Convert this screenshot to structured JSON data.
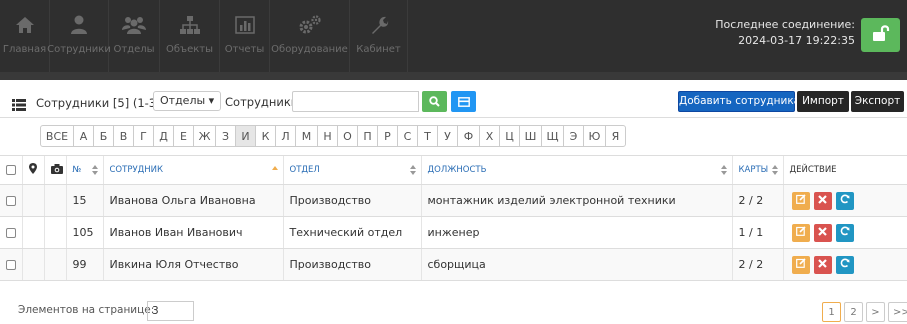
{
  "nav": {
    "items": [
      {
        "label": "Главная",
        "icon": "home-icon"
      },
      {
        "label": "Сотрудники",
        "icon": "user-icon"
      },
      {
        "label": "Отделы",
        "icon": "users-icon"
      },
      {
        "label": "Объекты",
        "icon": "sitemap-icon"
      },
      {
        "label": "Отчеты",
        "icon": "chart-icon"
      },
      {
        "label": "Оборудование",
        "icon": "gears-icon"
      },
      {
        "label": "Кабинет",
        "icon": "wrench-icon"
      }
    ]
  },
  "connection": {
    "label": "Последнее соединение:",
    "timestamp": "2024-03-17 19:22:35"
  },
  "toolbar": {
    "title": "Сотрудники [5] (1-3)",
    "departments_label": "Отделы ▾",
    "employees_label": "Сотрудники",
    "search_value": "",
    "add_label": "Добавить сотрудника",
    "import_label": "Импорт",
    "export_label": "Экспорт"
  },
  "alphabet": {
    "letters": [
      "ВСЕ",
      "А",
      "Б",
      "В",
      "Г",
      "Д",
      "Е",
      "Ж",
      "З",
      "И",
      "К",
      "Л",
      "М",
      "Н",
      "О",
      "П",
      "Р",
      "С",
      "Т",
      "У",
      "Ф",
      "Х",
      "Ц",
      "Ш",
      "Щ",
      "Э",
      "Ю",
      "Я"
    ],
    "active": "И"
  },
  "table": {
    "headers": {
      "num": "№",
      "employee": "Сотрудник",
      "department": "Отдел",
      "position": "Должность",
      "cards": "Карты",
      "action": "Действие"
    },
    "rows": [
      {
        "num": "15",
        "employee": "Иванова Ольга Ивановна",
        "department": "Производство",
        "position": "монтажник изделий электронной техники",
        "cards": "2 / 2"
      },
      {
        "num": "105",
        "employee": "Иванов Иван Иванович",
        "department": "Технический отдел",
        "position": "инженер",
        "cards": "1 / 1"
      },
      {
        "num": "99",
        "employee": "Ивкина Юля Отчество",
        "department": "Производство",
        "position": "сборщица",
        "cards": "2 / 2"
      }
    ]
  },
  "footer": {
    "per_page_label": "Элементов на странице:",
    "per_page_value": "3",
    "pages": [
      "1",
      "2",
      ">",
      ">>"
    ],
    "current_page": "1"
  },
  "colors": {
    "topbar": "#2f2f2f",
    "accent_green": "#5cb85c",
    "primary_blue": "#1565c0",
    "header_link": "#2a6db5"
  }
}
